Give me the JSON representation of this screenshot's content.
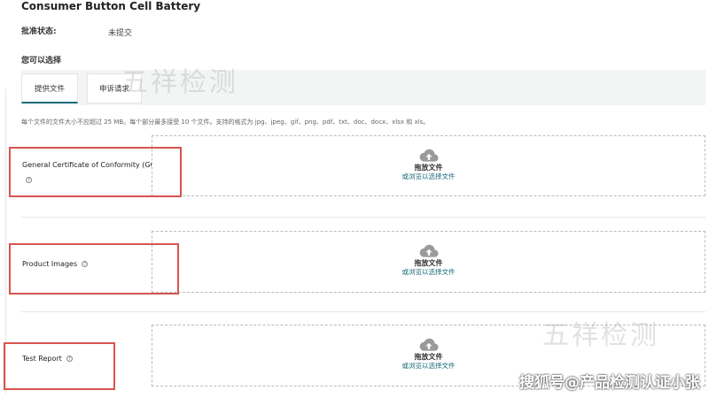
{
  "page": {
    "title": "Consumer Button Cell Battery",
    "approval_status_label": "批准状态:",
    "approval_status_value": "未提交",
    "choose_label": "您可以选择"
  },
  "tabs": [
    {
      "label": "提供文件",
      "active": true
    },
    {
      "label": "申诉请求",
      "active": false
    }
  ],
  "upload_hint": "每个文件的文件大小不应超过 25 MB。每个部分最多接受 10 个文件。支持的格式为 jpg、jpeg、gif、png、pdf、txt、doc、docx、xlsx 和 xls。",
  "fields": [
    {
      "label": "General Certificate of Conformity (GCC)",
      "help_icon": "question-circle-icon",
      "drop_title": "拖放文件",
      "drop_link": "或浏览以选择文件"
    },
    {
      "label": "Product Images",
      "help_icon": "question-circle-icon",
      "drop_title": "拖放文件",
      "drop_link": "或浏览以选择文件"
    },
    {
      "label": "Test Report",
      "help_icon": "question-circle-icon",
      "drop_title": "拖放文件",
      "drop_link": "或浏览以选择文件"
    }
  ],
  "watermarks": {
    "center": "五祥检测",
    "corner": "搜狐号@产品检测认证小张"
  },
  "colors": {
    "accent": "#1a6c7a",
    "highlight_box": "#d9534f",
    "cloud_icon": "#9a9a9a"
  }
}
